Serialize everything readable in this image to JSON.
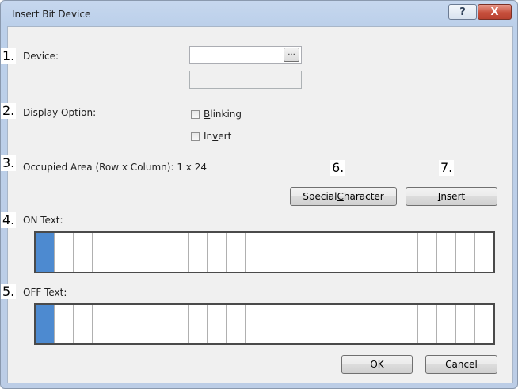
{
  "window": {
    "title": "Insert Bit Device"
  },
  "titlebar": {
    "help_label": "?",
    "close_label": "X"
  },
  "markers": [
    "1.",
    "2.",
    "3.",
    "4.",
    "5.",
    "6.",
    "7."
  ],
  "device": {
    "label": "Device:",
    "value": "",
    "browse_label": "...",
    "description": ""
  },
  "display_option": {
    "label": "Display Option:",
    "blinking": {
      "label_pre": "",
      "mnemonic": "B",
      "label_post": "linking",
      "checked": false
    },
    "invert": {
      "label_pre": "In",
      "mnemonic": "v",
      "label_post": "ert",
      "checked": false
    }
  },
  "occupied_area": {
    "label": "Occupied Area (Row x Column):",
    "value": "1 x 24"
  },
  "buttons": {
    "special_pre": "Special ",
    "special_mnemonic": "C",
    "special_post": "haracter",
    "insert_pre": "",
    "insert_mnemonic": "I",
    "insert_post": "nsert",
    "ok": "OK",
    "cancel": "Cancel"
  },
  "on_text": {
    "label": "ON Text:",
    "columns": 24,
    "cursor_index": 0,
    "value": ""
  },
  "off_text": {
    "label": "OFF Text:",
    "columns": 24,
    "cursor_index": 0,
    "value": ""
  },
  "colors": {
    "cursor": "#4d8ad0",
    "dialog_bg": "#f0f0f0",
    "frame": "#bcd0ea"
  }
}
